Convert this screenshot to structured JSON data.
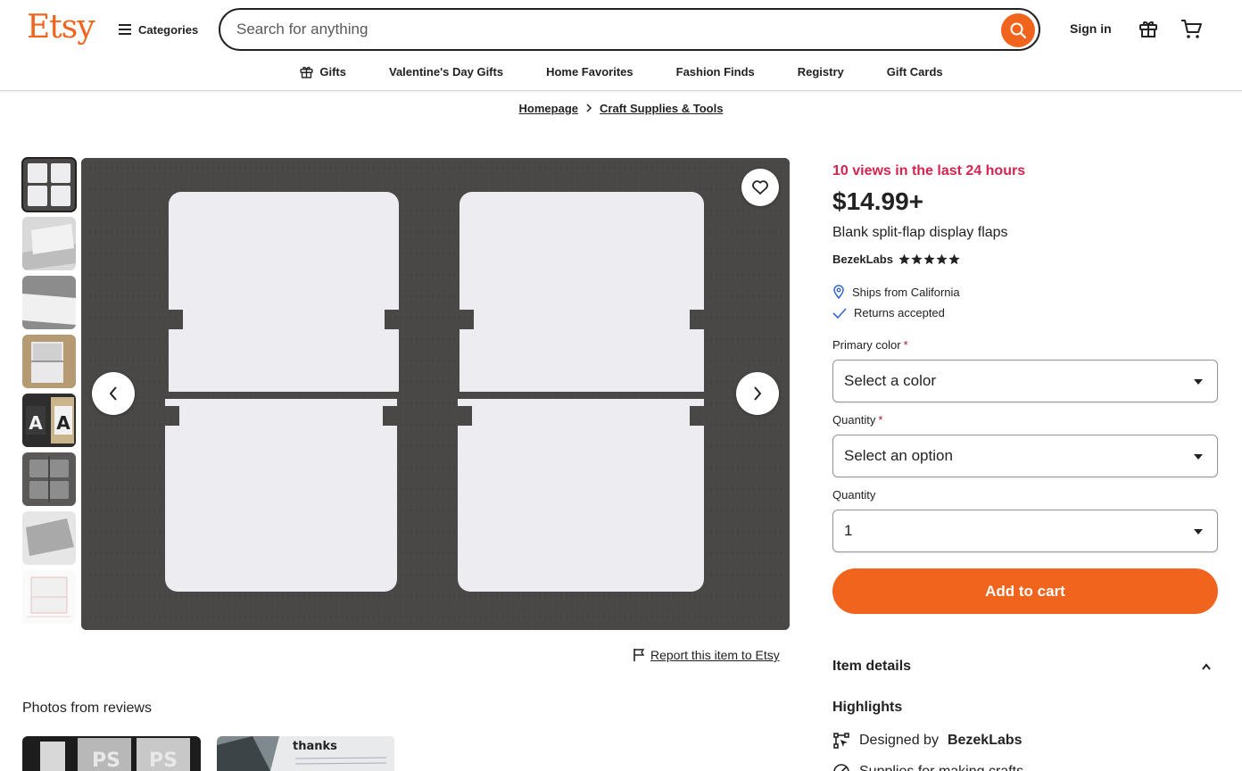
{
  "header": {
    "logo": "Etsy",
    "categories_label": "Categories",
    "search_placeholder": "Search for anything",
    "sign_in": "Sign in"
  },
  "subnav": [
    {
      "label": "Gifts",
      "icon": "gift-icon"
    },
    {
      "label": "Valentine's Day Gifts"
    },
    {
      "label": "Home Favorites"
    },
    {
      "label": "Fashion Finds"
    },
    {
      "label": "Registry"
    },
    {
      "label": "Gift Cards"
    }
  ],
  "breadcrumb": [
    "Homepage",
    "Craft Supplies & Tools"
  ],
  "gallery": {
    "thumbnail_count": 8,
    "report_link": "Report this item to Etsy"
  },
  "reviews": {
    "title": "Photos from reviews",
    "photo2_text": "thanks"
  },
  "product": {
    "views": "10 views in the last 24 hours",
    "price": "$14.99+",
    "title": "Blank split-flap display flaps",
    "shop": "BezekLabs",
    "rating": 5,
    "ships_from": "Ships from California",
    "returns": "Returns accepted",
    "primary_color_label": "Primary color",
    "primary_color_value": "Select a color",
    "quantity_option_label": "Quantity",
    "quantity_option_value": "Select an option",
    "quantity_label": "Quantity",
    "quantity_value": "1",
    "add_to_cart": "Add to cart",
    "item_details": "Item details",
    "highlights": "Highlights",
    "designed_by_prefix": "Designed by",
    "designed_by": "BezekLabs",
    "partial_row_text": "Supplies for making crafts"
  },
  "colors": {
    "brand": "#f1641e",
    "views": "#d5244e",
    "required": "#a61a2e"
  }
}
